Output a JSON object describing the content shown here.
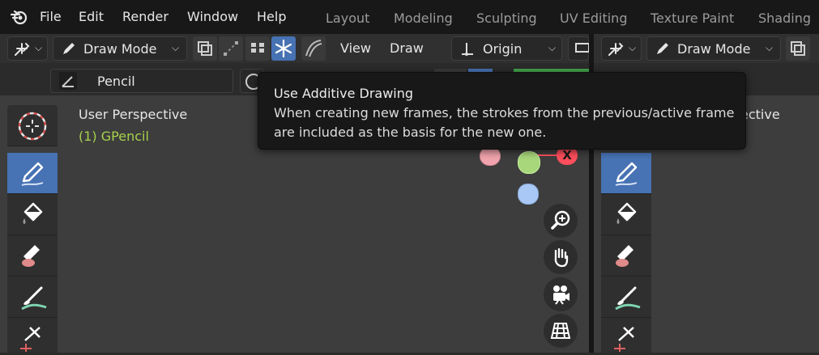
{
  "menubar": {
    "items": [
      "File",
      "Edit",
      "Render",
      "Window",
      "Help"
    ],
    "workspaces": [
      "Layout",
      "Modeling",
      "Sculpting",
      "UV Editing",
      "Texture Paint",
      "Shading"
    ]
  },
  "header": {
    "mode_label": "Draw Mode",
    "view_label": "View",
    "draw_label": "Draw",
    "pivot_label": "Origin",
    "brush_name": "Pencil"
  },
  "viewport": {
    "perspective_label": "User Perspective",
    "object_label": "(1) GPencil",
    "gizmo_x_label": "X"
  },
  "right_area": {
    "mode_label": "Draw Mode",
    "perspective_fragment": "ective"
  },
  "tooltip": {
    "title": "Use Additive Drawing",
    "line1": "When creating new frames, the strokes from the previous/active frame",
    "line2": "are included as the basis for the new one."
  },
  "colors": {
    "active_tool": "#4772b3",
    "object_label": "#a7d14d",
    "gizmo_x": "#ff4e5c",
    "gizmo_y": "#a8d67a",
    "gizmo_z": "#a9c8f5"
  },
  "icons": {
    "blender_logo": "blender-logo-icon",
    "cursor_tool": "cursor-icon",
    "draw_tool": "pencil-draw-icon",
    "fill_tool": "fill-bucket-icon",
    "erase_tool": "eraser-icon",
    "tint_tool": "tint-brush-icon",
    "cutter_tool": "cutter-icon"
  }
}
